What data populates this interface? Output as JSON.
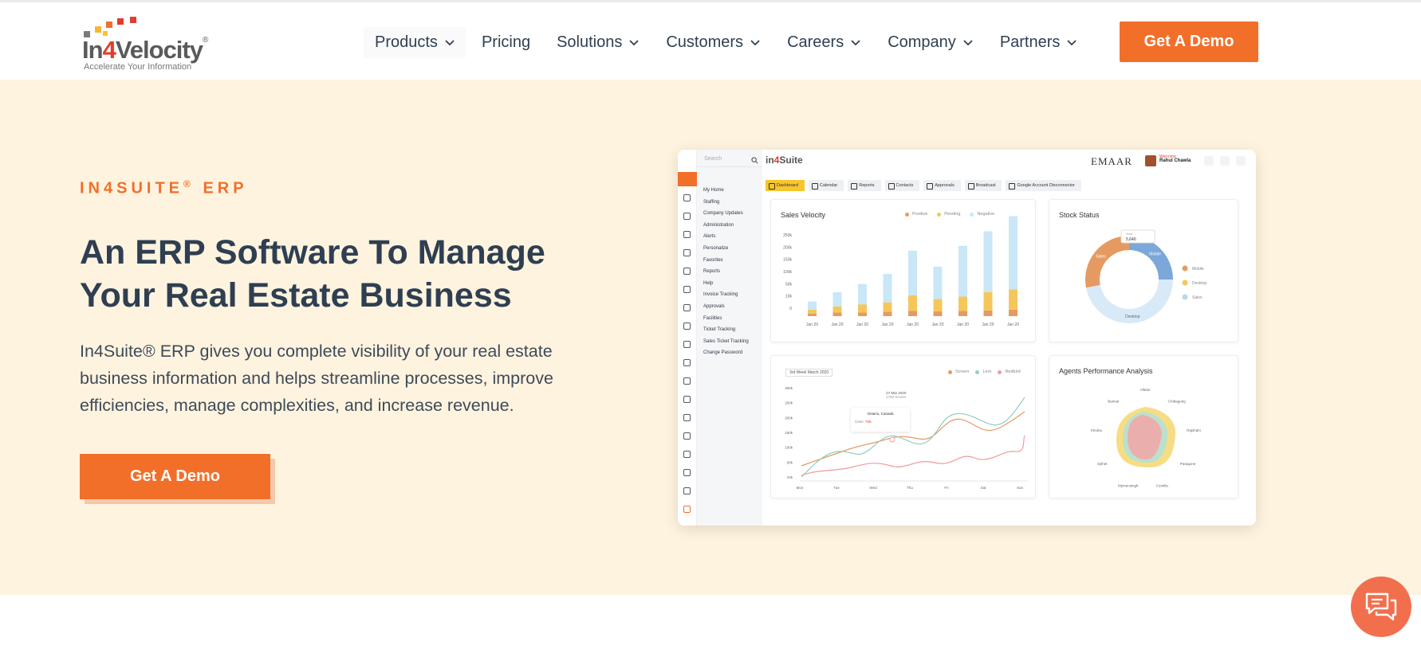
{
  "brand": {
    "name_prefix": "In",
    "name_red": "4",
    "name_suffix": "Velocity",
    "registered": "®",
    "tagline": "Accelerate Your Information"
  },
  "nav": {
    "items": [
      {
        "label": "Products",
        "dropdown": true
      },
      {
        "label": "Pricing",
        "dropdown": false
      },
      {
        "label": "Solutions",
        "dropdown": true
      },
      {
        "label": "Customers",
        "dropdown": true
      },
      {
        "label": "Careers",
        "dropdown": true
      },
      {
        "label": "Company",
        "dropdown": true
      },
      {
        "label": "Partners",
        "dropdown": true
      }
    ],
    "cta_label": "Get A Demo"
  },
  "hero": {
    "eyebrow_main": "IN4SUITE",
    "eyebrow_reg": "®",
    "eyebrow_tail": "ERP",
    "headline": "An ERP Software To Manage Your Real Estate Business",
    "subtext": "In4Suite® ERP gives you complete visibility of your real estate business information and helps streamline processes, improve efficiencies, manage complexities, and increase revenue.",
    "cta_label": "Get A Demo"
  },
  "dashboard": {
    "search_placeholder": "Search",
    "logo_prefix": "in",
    "logo_red": "4",
    "logo_suffix": "Suite",
    "client": "EMAAR",
    "user_greeting": "Welcome",
    "user_name": "Rahul Chawla",
    "menu": [
      "My Home",
      "Staffing",
      "Company Updates",
      "Administration",
      "Alerts",
      "Personalize",
      "Favorites",
      "Reports",
      "Help",
      "Invoice Tracking",
      "Approvals",
      "Facilities",
      "Ticket Tracking",
      "Sales Ticket Tracking",
      "Change Password"
    ],
    "tabs": [
      "Dashboard",
      "Calendar",
      "Reports",
      "Contacts",
      "Approvals",
      "Broadcast",
      "Google Account Disconnector"
    ],
    "sales_velocity": {
      "title": "Sales Velocity",
      "legend": [
        "Positive",
        "Pending",
        "Negative"
      ],
      "colors": [
        "#e59a62",
        "#f5c75b",
        "#c9e7f7"
      ],
      "y_ticks": [
        "250k",
        "200k",
        "150k",
        "100k",
        "50k",
        "10k",
        "0"
      ],
      "categories": [
        "Jan 20",
        "Jan 20",
        "Jan 20",
        "Jan 20",
        "Jan 20",
        "Jan 20",
        "Jan 20",
        "Jan 20",
        "Jan 20"
      ],
      "positive": [
        6,
        9,
        9,
        11,
        13,
        12,
        13,
        14,
        16
      ],
      "pending": [
        10,
        15,
        20,
        23,
        38,
        30,
        35,
        45,
        50
      ],
      "negative": [
        20,
        35,
        50,
        70,
        110,
        80,
        125,
        150,
        180
      ]
    },
    "stock_status": {
      "title": "Stock Status",
      "tooltip_label": "Sold",
      "tooltip_value": "5,640",
      "labels": [
        "Mobile",
        "Desktop",
        "Sales"
      ],
      "legend": [
        "Mobile",
        "Desktop",
        "Sales"
      ],
      "values": [
        25,
        47,
        28
      ],
      "colors": [
        "#7ba7d9",
        "#d8e9f8",
        "#e59a62"
      ],
      "legend_colors": [
        "#e59a62",
        "#f5c75b",
        "#b8d8ee"
      ]
    },
    "line_chart": {
      "dropdown": "3rd Week March 2020",
      "legend": [
        "Screen",
        "Lern",
        "Redbird"
      ],
      "colors": [
        "#e59a62",
        "#8fcfc0",
        "#f19aa0"
      ],
      "y_ticks": [
        "300k",
        "250k",
        "200k",
        "150k",
        "100k",
        "50k",
        "10k"
      ],
      "x_ticks": [
        "Mon",
        "Tue",
        "Wed",
        "Thu",
        "Fri",
        "Sat",
        "Sun"
      ],
      "tooltip_date": "27 Mar 2020",
      "tooltip_sub": "1768 Screen",
      "tooltip_place": "Ontario, Canada",
      "tooltip_label": "Case:",
      "tooltip_value": "768"
    },
    "agents": {
      "title": "Agents Performance Analysis",
      "axes": [
        "Alfedo",
        "Chittagong",
        "Rajshahi",
        "Paragone",
        "Comilla",
        "Mymensingh",
        "Sylhet",
        "Khulna",
        "Barisal"
      ]
    }
  }
}
